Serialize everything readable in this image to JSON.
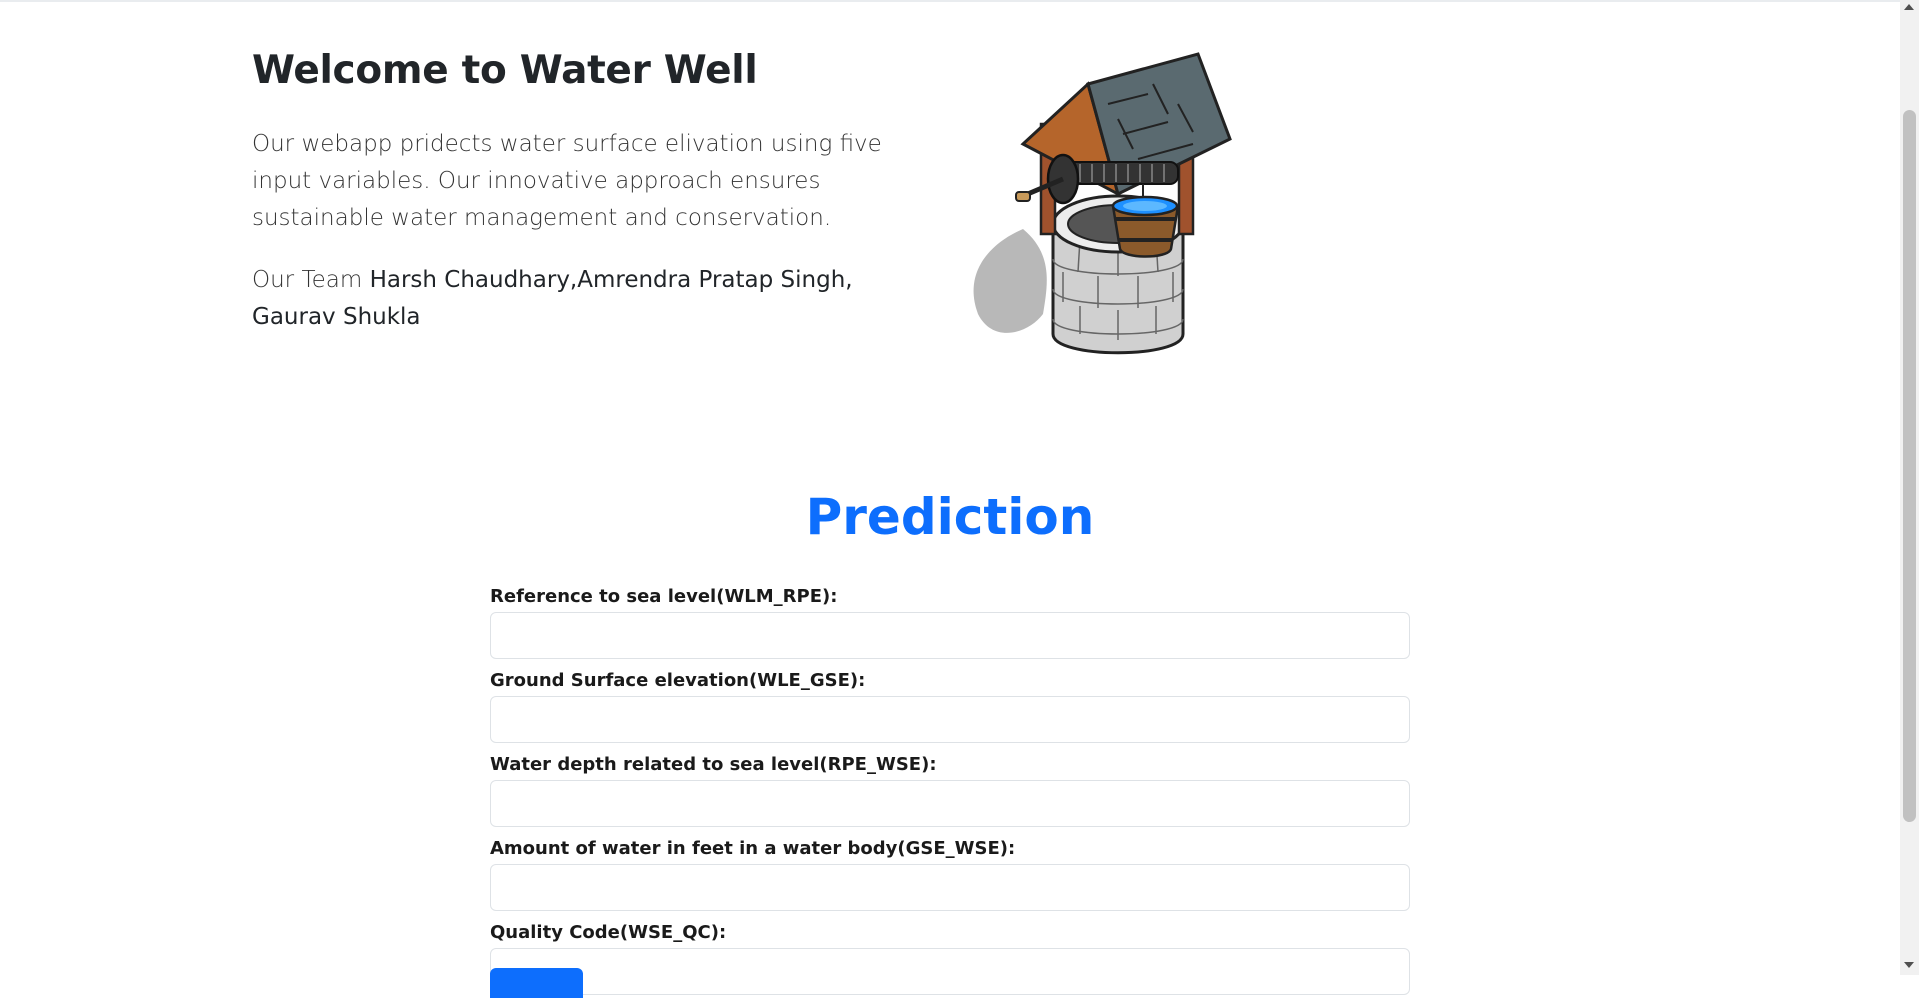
{
  "hero": {
    "title": "Welcome to Water Well",
    "description": "Our webapp pridects water surface elivation using five input variables. Our innovative approach ensures sustainable water management and conservation.",
    "team_label": "Our Team",
    "team_names": "Harsh Chaudhary,Amrendra Pratap Singh, Gaurav Shukla",
    "image_icon": "wishing-well-illustration"
  },
  "prediction": {
    "title": "Prediction",
    "fields": [
      {
        "label": "Reference to sea level(WLM_RPE):",
        "value": ""
      },
      {
        "label": "Ground Surface elevation(WLE_GSE):",
        "value": ""
      },
      {
        "label": "Water depth related to sea level(RPE_WSE):",
        "value": ""
      },
      {
        "label": "Amount of water in feet in a water body(GSE_WSE):",
        "value": ""
      },
      {
        "label": "Quality Code(WSE_QC):",
        "value": ""
      }
    ]
  },
  "colors": {
    "accent": "#0d6efd",
    "text": "#212529",
    "input_border": "#dee2e6"
  }
}
